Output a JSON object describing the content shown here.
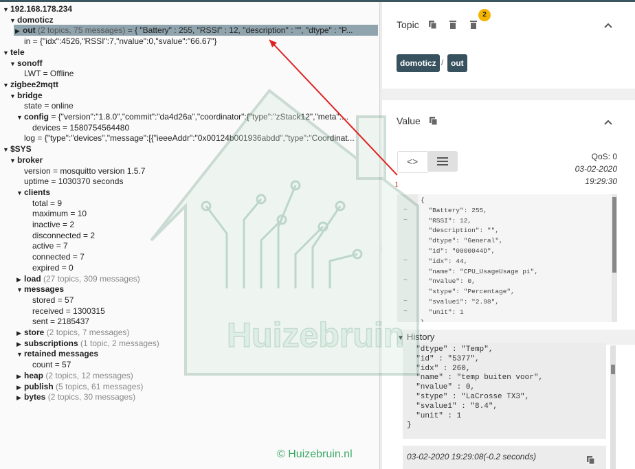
{
  "tree": [
    {
      "depth": 0,
      "open": true,
      "key": "192.168.178.234",
      "bold": true
    },
    {
      "depth": 1,
      "open": true,
      "key": "domoticz",
      "bold": true
    },
    {
      "depth": 2,
      "open": false,
      "key": "out",
      "bold": true,
      "meta": "(2 topics, 75 messages)",
      "value": " = { \"Battery\" : 255, \"RSSI\" : 12, \"description\" : \"\", \"dtype\" : \"P...",
      "selected": true
    },
    {
      "depth": 2,
      "leaf": true,
      "key": "in",
      "value": " = {\"idx\":4526,\"RSSI\":7,\"nvalue\":0,\"svalue\":\"66.67\"}"
    },
    {
      "depth": 0,
      "open": true,
      "key": "tele",
      "bold": true
    },
    {
      "depth": 1,
      "open": true,
      "key": "sonoff",
      "bold": true
    },
    {
      "depth": 2,
      "leaf": true,
      "key": "LWT",
      "value": " = Offline"
    },
    {
      "depth": 0,
      "open": true,
      "key": "zigbee2mqtt",
      "bold": true
    },
    {
      "depth": 1,
      "open": true,
      "key": "bridge",
      "bold": true
    },
    {
      "depth": 2,
      "leaf": true,
      "key": "state",
      "value": " = online"
    },
    {
      "depth": 2,
      "open": true,
      "key": "config",
      "bold": true,
      "value": " = {\"version\":\"1.8.0\",\"commit\":\"da4d26a\",\"coordinator\":{\"type\":\"zStack12\",\"meta\":..."
    },
    {
      "depth": 3,
      "leaf": true,
      "key": "devices",
      "value": " = 1580754564480"
    },
    {
      "depth": 2,
      "leaf": true,
      "key": "log",
      "value": " = {\"type\":\"devices\",\"message\":[{\"ieeeAddr\":\"0x00124b001936abdd\",\"type\":\"Coordinat..."
    },
    {
      "depth": 0,
      "open": true,
      "key": "$SYS",
      "bold": true
    },
    {
      "depth": 1,
      "open": true,
      "key": "broker",
      "bold": true
    },
    {
      "depth": 2,
      "leaf": true,
      "key": "version",
      "value": " = mosquitto version 1.5.7"
    },
    {
      "depth": 2,
      "leaf": true,
      "key": "uptime",
      "value": " = 1030370 seconds"
    },
    {
      "depth": 2,
      "open": true,
      "key": "clients",
      "bold": true
    },
    {
      "depth": 3,
      "leaf": true,
      "key": "total",
      "value": " = 9"
    },
    {
      "depth": 3,
      "leaf": true,
      "key": "maximum",
      "value": " = 10"
    },
    {
      "depth": 3,
      "leaf": true,
      "key": "inactive",
      "value": " = 2"
    },
    {
      "depth": 3,
      "leaf": true,
      "key": "disconnected",
      "value": " = 2"
    },
    {
      "depth": 3,
      "leaf": true,
      "key": "active",
      "value": " = 7"
    },
    {
      "depth": 3,
      "leaf": true,
      "key": "connected",
      "value": " = 7"
    },
    {
      "depth": 3,
      "leaf": true,
      "key": "expired",
      "value": " = 0"
    },
    {
      "depth": 2,
      "open": false,
      "key": "load",
      "bold": true,
      "meta": "(27 topics, 309 messages)"
    },
    {
      "depth": 2,
      "open": true,
      "key": "messages",
      "bold": true
    },
    {
      "depth": 3,
      "leaf": true,
      "key": "stored",
      "value": " = 57"
    },
    {
      "depth": 3,
      "leaf": true,
      "key": "received",
      "value": " = 1300315"
    },
    {
      "depth": 3,
      "leaf": true,
      "key": "sent",
      "value": " = 2185437"
    },
    {
      "depth": 2,
      "open": false,
      "key": "store",
      "bold": true,
      "meta": "(2 topics, 7 messages)"
    },
    {
      "depth": 2,
      "open": false,
      "key": "subscriptions",
      "bold": true,
      "meta": "(1 topic, 2 messages)"
    },
    {
      "depth": 2,
      "open": true,
      "key": "retained messages",
      "bold": true
    },
    {
      "depth": 3,
      "leaf": true,
      "key": "count",
      "value": " = 57"
    },
    {
      "depth": 2,
      "open": false,
      "key": "heap",
      "bold": true,
      "meta": "(2 topics, 12 messages)"
    },
    {
      "depth": 2,
      "open": false,
      "key": "publish",
      "bold": true,
      "meta": "(5 topics, 61 messages)"
    },
    {
      "depth": 2,
      "open": false,
      "key": "bytes",
      "bold": true,
      "meta": "(2 topics, 30 messages)"
    }
  ],
  "topic": {
    "title": "Topic",
    "badge": "2",
    "chips": [
      "domoticz",
      "out"
    ],
    "separator": "/"
  },
  "value": {
    "title": "Value",
    "qos": "QoS: 0",
    "date": "03-02-2020",
    "time": "19:29:30",
    "json_lines": [
      "{",
      "  \"Battery\": 255,",
      "  \"RSSI\": 12,",
      "  \"description\": \"\",",
      "  \"dtype\": \"General\",",
      "  \"id\": \"0000044D\",",
      "  \"idx\": 44,",
      "  \"name\": \"CPU_UsageUsage pi\",",
      "  \"nvalue\": 0,",
      "  \"stype\": \"Percentage\",",
      "  \"svalue1\": \"2.98\",",
      "  \"unit\": 1",
      "}"
    ]
  },
  "history": {
    "title": "History",
    "lines": [
      "  \"dtype\" : \"Temp\",",
      "  \"id\" : \"5377\",",
      "  \"idx\" : 260,",
      "  \"name\" : \"temp buiten voor\",",
      "  \"nvalue\" : 0,",
      "  \"stype\" : \"LaCrosse TX3\",",
      "  \"svalue1\" : \"8.4\",",
      "  \"unit\" : 1",
      "}"
    ],
    "entry2": "03-02-2020 19:29:08(-0.2 seconds)"
  },
  "annotation": {
    "label": "1",
    "watermark": "Huizebruin",
    "copyright": "© Huizebruin.nl"
  },
  "colors": {
    "chip": "#37515f",
    "badge": "#f5b400",
    "selected_row": "#90a4ae",
    "arrow": "#e02020",
    "watermark": "#3aa864"
  }
}
